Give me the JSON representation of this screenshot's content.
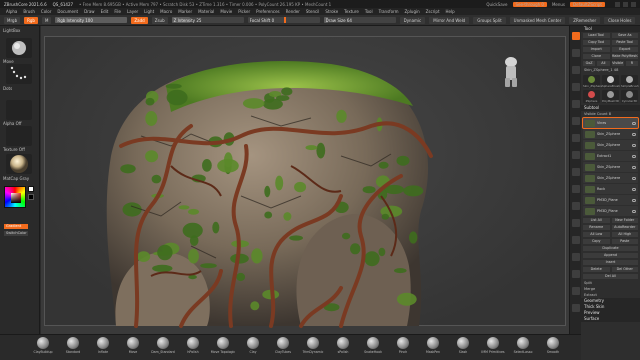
{
  "titlebar": {
    "app": "ZBrushCore 2021.6.6",
    "file": "QS_61427",
    "stats": "• Free Mem 8.695GB • Active Mem 797 • Scratch Disk 53 • ZTime 1.316 • Timer 0.006 • PolyCount 26.195 KP • MeshCount 1",
    "right_items": [
      "QuickSave",
      "See-through 0",
      "Menus",
      "DefaultZScript"
    ]
  },
  "menubar": [
    "Alpha",
    "Brush",
    "Color",
    "Document",
    "Draw",
    "Edit",
    "File",
    "Layer",
    "Light",
    "Macro",
    "Marker",
    "Material",
    "Movie",
    "Picker",
    "Preferences",
    "Render",
    "Stencil",
    "Stroke",
    "Texture",
    "Tool",
    "Transform",
    "Zplugin",
    "Zscript",
    "Help"
  ],
  "toolbar": {
    "mrgb": "Mrgb",
    "rgb": "Rgb",
    "m": "M",
    "rgb_intensity_label": "Rgb Intensity",
    "rgb_intensity": 100,
    "zadd": "Zadd",
    "zsub": "Zsub",
    "zintensity_label": "Z Intensity",
    "zintensity": 25,
    "focal_label": "Focal Shift",
    "focal": 0,
    "draw_size_label": "Draw Size",
    "draw_size": 64,
    "dynamic": "Dynamic",
    "mirror": "Mirror And Weld",
    "groups_split": "Groups Split",
    "unmasked": "Unmasked Mesh Center",
    "zremesher": "ZRemesher",
    "close_holes": "Close Holes",
    "delete_hidden": "Delete Hidden"
  },
  "left": {
    "lightbox": "LightBox",
    "brush": "Move",
    "stroke": "Dots",
    "alpha": "Alpha Off",
    "texture": "Texture Off",
    "material": "MatCap Gray",
    "gradient": "Gradient",
    "switch_color": "SwitchColor",
    "main_color": "#ffffff",
    "alt_color": "#000000"
  },
  "palette": {
    "header": "Tool",
    "load_tool": "Load Tool",
    "save_as": "Save As",
    "copy_tool": "Copy Tool",
    "paste_tool": "Paste Tool",
    "import": "Import",
    "export": "Export",
    "clone": "Clone",
    "make_polymesh": "Make PolyMesh3D",
    "goz": "GoZ",
    "all": "All",
    "visible": "Visible",
    "r": "R",
    "current_tool": "Skin_ZSphere_1 48",
    "tool_thumbs": [
      "Skin_ZSphere",
      "SphereBrush",
      "SimpleBrush",
      "ZSphere",
      "PolyMesh3D",
      "Cylinder3D"
    ],
    "subtool_header": "Subtool",
    "visible_count": "Visible Count 8",
    "subtools": [
      "Vines",
      "Skin_ZSphere",
      "Skin_ZSphere",
      "Extract1",
      "Skin_ZSphere",
      "Skin_ZSphere",
      "Rock",
      "PM3D_Plane",
      "PM3D_Plane"
    ],
    "list_all": "List All",
    "new_folder": "New Folder",
    "rename": "Rename",
    "auto_reorder": "AutoReorder",
    "all_low": "All Low",
    "all_high": "All High",
    "copy": "Copy",
    "paste": "Paste",
    "duplicate": "Duplicate",
    "append": "Append",
    "insert": "Insert",
    "delete": "Delete",
    "del_other": "Del Other",
    "del_all": "Del All",
    "split": "Split",
    "merge": "Merge",
    "extract": "Extract",
    "geometry": "Geometry",
    "thick_skin": "Thick Skin",
    "preview": "Preview",
    "surface": "Surface"
  },
  "bottom_brushes": [
    "ClayBuildup",
    "Standard",
    "Inflate",
    "Move",
    "Dam_Standard",
    "hPolish",
    "Move Topologic",
    "Clay",
    "ClayTubes",
    "TrimDynamic",
    "sPolish",
    "SnakeHook",
    "Pinch",
    "MaskPen",
    "Slash",
    "IMM Primitives",
    "SelectLasso",
    "Smooth"
  ],
  "colors": {
    "accent": "#f26b1d",
    "moss": "#5b8a2a",
    "rock": "#8b7a66",
    "vine": "#7a3a22"
  },
  "icons": [
    "navigation-cube-icon",
    "scroll-icon",
    "zoom-icon",
    "actual-icon",
    "aahalf-icon",
    "persp-icon",
    "floor-icon",
    "local-icon",
    "xyz-icon",
    "frame-icon",
    "move-icon",
    "scale-icon",
    "rotate-icon",
    "polyf-icon",
    "transp-icon",
    "ghost-icon",
    "solo-icon",
    "xpose-icon"
  ]
}
